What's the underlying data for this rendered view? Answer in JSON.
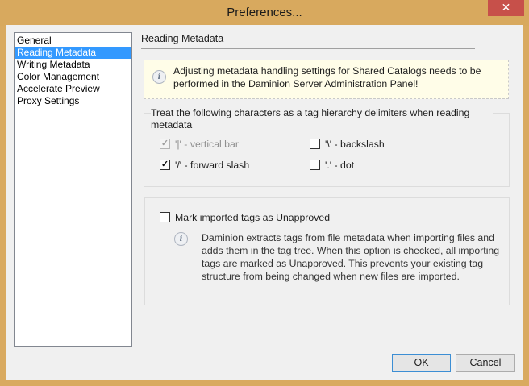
{
  "window": {
    "title": "Preferences...",
    "close_glyph": "✕",
    "accent_color": "#d8a95e"
  },
  "sidebar": {
    "items": [
      {
        "label": "General",
        "selected": false
      },
      {
        "label": "Reading Metadata",
        "selected": true
      },
      {
        "label": "Writing Metadata",
        "selected": false
      },
      {
        "label": "Color Management",
        "selected": false
      },
      {
        "label": "Accelerate Preview",
        "selected": false
      },
      {
        "label": "Proxy Settings",
        "selected": false
      }
    ]
  },
  "main": {
    "section_title": "Reading Metadata",
    "info": {
      "icon": "info-icon",
      "text": "Adjusting metadata handling settings for Shared Catalogs needs to be performed in the Daminion Server Administration Panel!"
    },
    "delimiters": {
      "label": "Treat the following characters as a tag hierarchy delimiters when reading metadata",
      "options": [
        {
          "label": "'|' - vertical bar",
          "checked": true,
          "disabled": true
        },
        {
          "label": "'\\' - backslash",
          "checked": false,
          "disabled": false
        },
        {
          "label": "'/' - forward slash",
          "checked": true,
          "disabled": false
        },
        {
          "label": "'.' - dot",
          "checked": false,
          "disabled": false
        }
      ]
    },
    "unapproved": {
      "label": "Mark imported tags as Unapproved",
      "checked": false,
      "description": "Daminion extracts tags from file metadata when importing files and adds them in the tag tree. When this option is checked, all importing tags are marked as Unapproved. This prevents your existing tag structure from being changed when new files are imported."
    }
  },
  "buttons": {
    "ok": "OK",
    "cancel": "Cancel"
  },
  "glyphs": {
    "check": "✓",
    "info": "i"
  }
}
